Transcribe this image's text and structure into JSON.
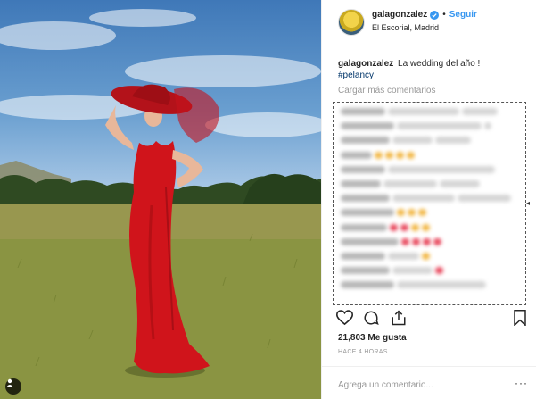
{
  "post": {
    "username": "galagonzalez",
    "follow_label": "Seguir",
    "location": "El Escorial, Madrid",
    "dot": "•"
  },
  "caption": {
    "username": "galagonzalez",
    "text": "La wedding del año !",
    "hashtag": "#pelancy"
  },
  "comments": {
    "load_more_label": "Cargar más comentarios"
  },
  "likes": {
    "count_label": "21,803 Me gusta"
  },
  "timestamp": "HACE 4 HORAS",
  "comment_box": {
    "placeholder": "Agrega un comentario...",
    "more_label": "···"
  },
  "colors": {
    "link_blue": "#3897f0",
    "hashtag_blue": "#003569",
    "dress_red": "#d0141b"
  },
  "icons": [
    "verified-icon",
    "heart-icon",
    "comment-icon",
    "share-icon",
    "bookmark-icon",
    "user-tag-icon"
  ]
}
